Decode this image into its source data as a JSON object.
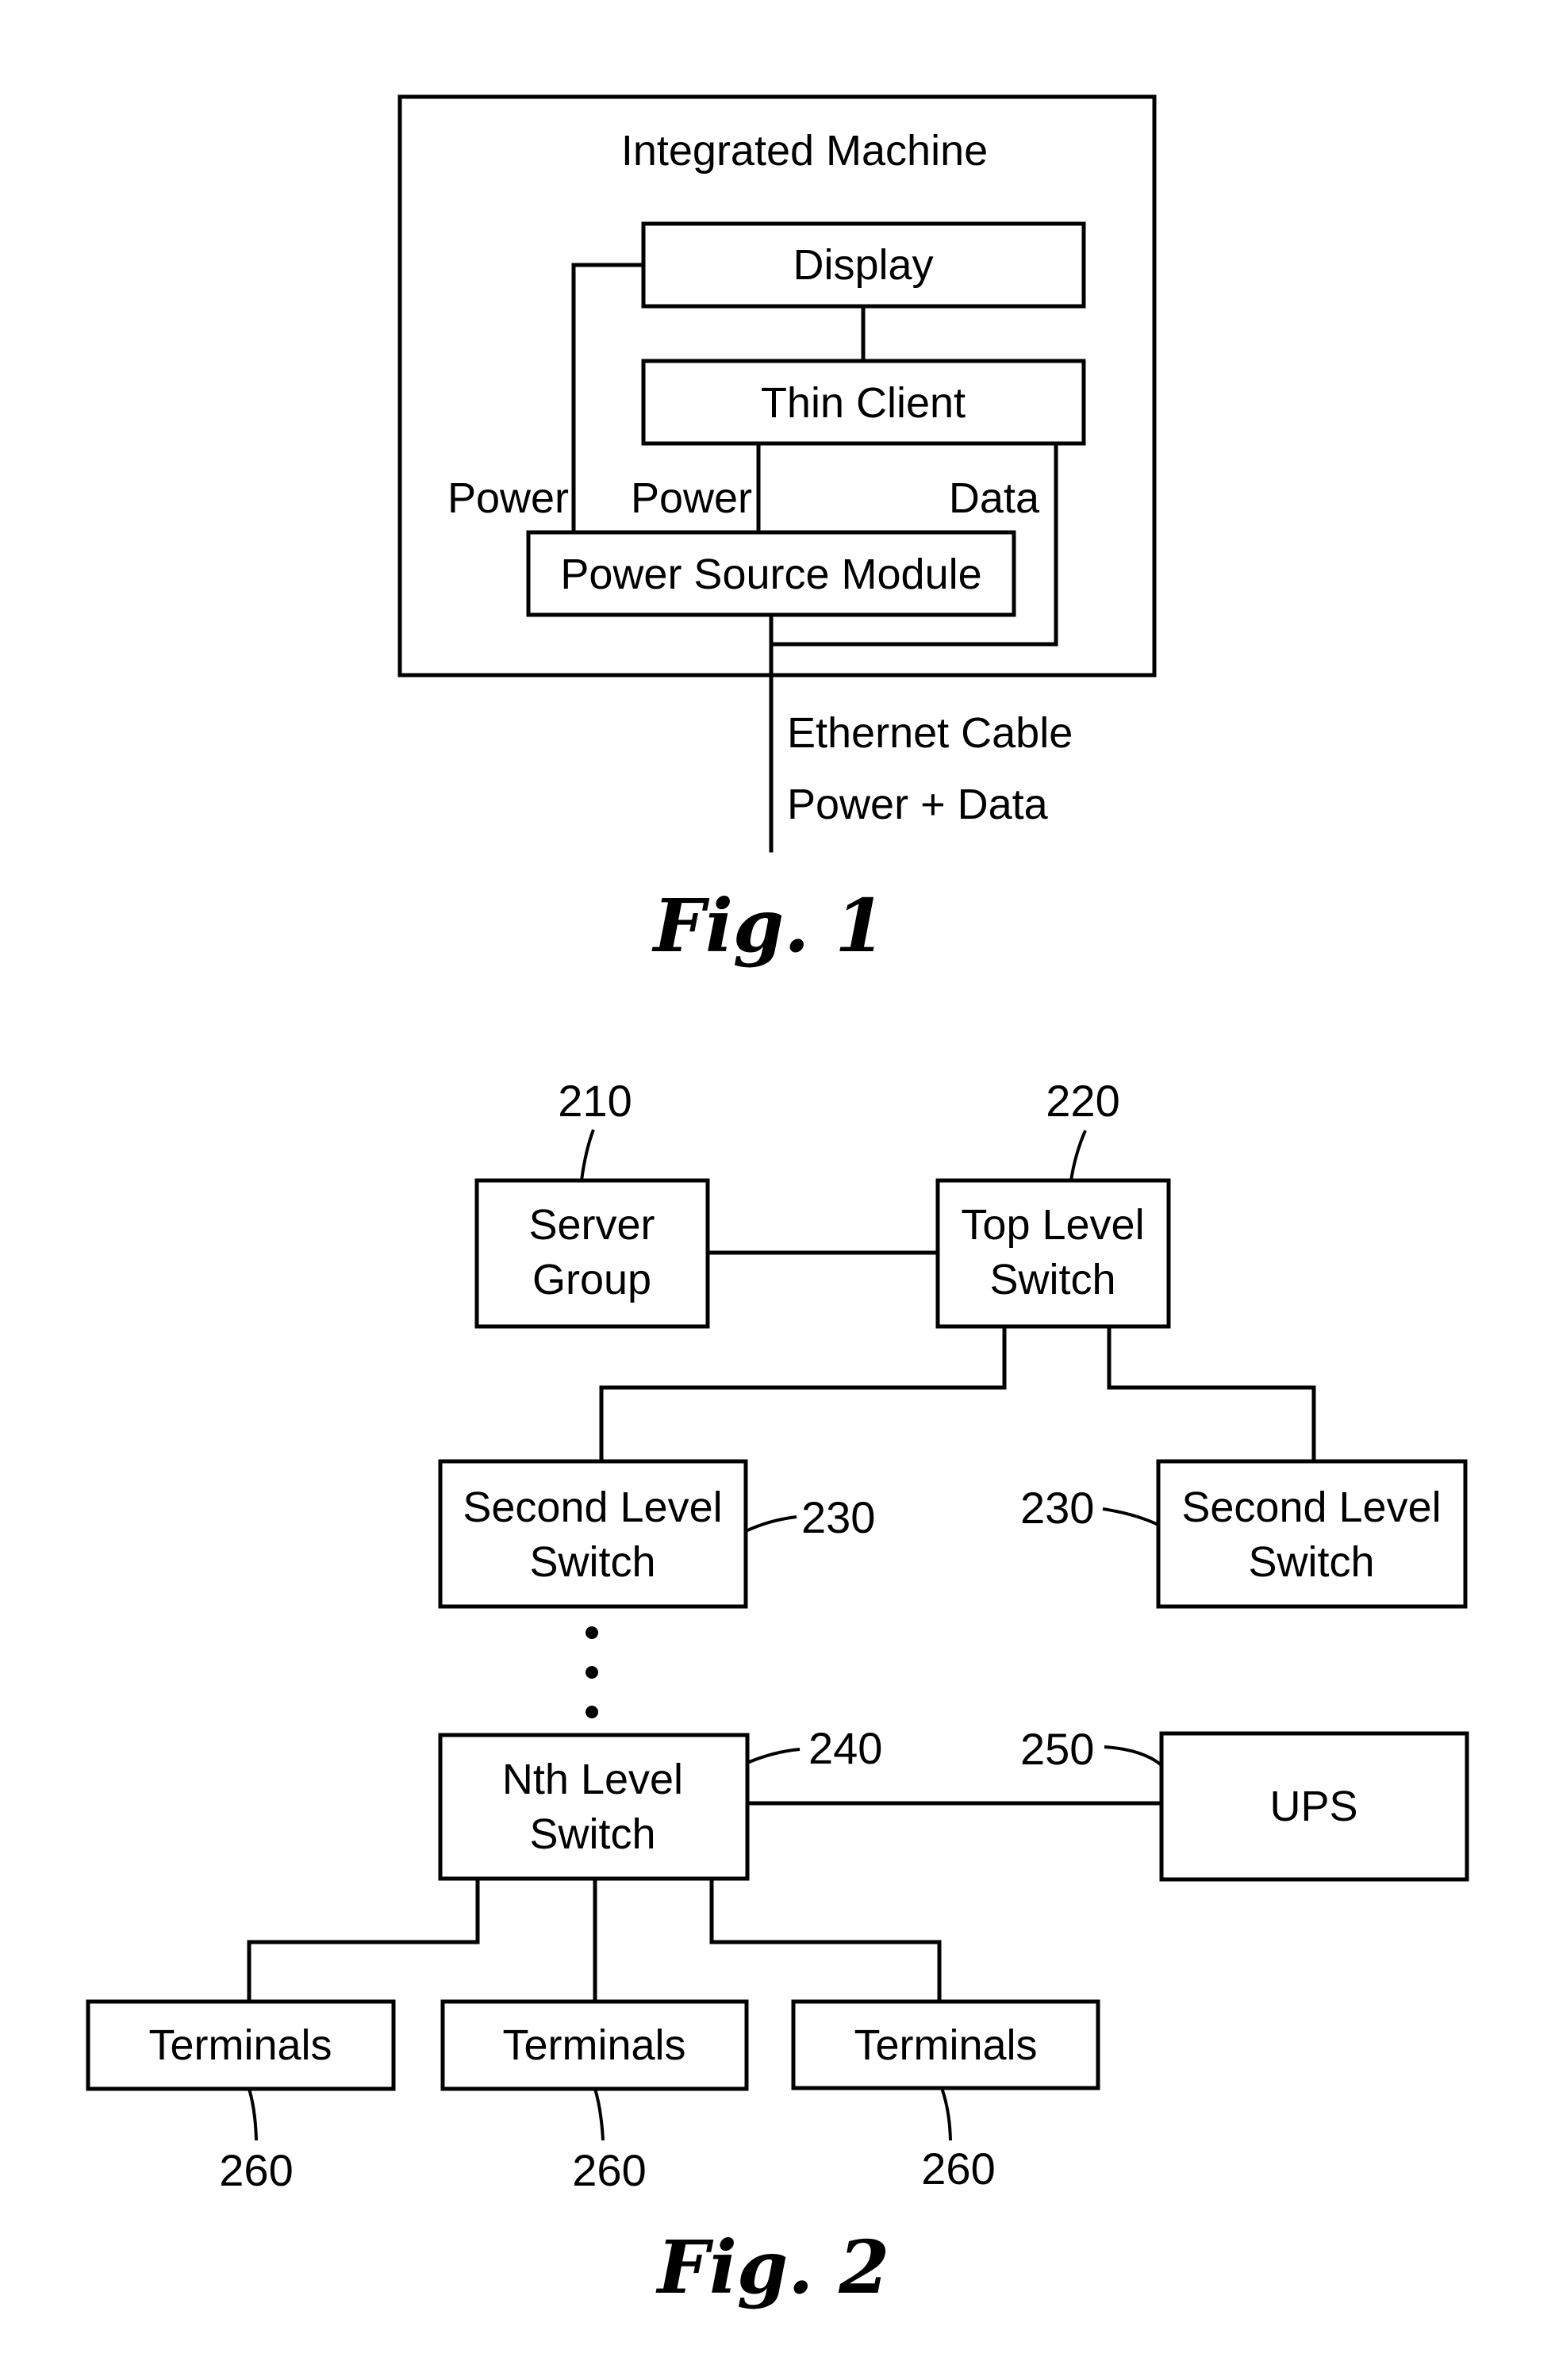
{
  "figure1": {
    "caption": "Fig. 1",
    "container_label": "Integrated Machine",
    "blocks": {
      "display": "Display",
      "thin_client": "Thin Client",
      "power_source_module": "Power Source Module"
    },
    "wire_labels": {
      "power_to_display": "Power",
      "power_to_thin_client": "Power",
      "data": "Data"
    },
    "cable_labels": [
      "Ethernet Cable",
      "Power + Data"
    ]
  },
  "figure2": {
    "caption": "Fig. 2",
    "nodes": {
      "server_group": {
        "lines": [
          "Server",
          "Group"
        ],
        "ref": "210"
      },
      "top_level_switch": {
        "lines": [
          "Top Level",
          "Switch"
        ],
        "ref": "220"
      },
      "second_level_switch_left": {
        "lines": [
          "Second Level",
          "Switch"
        ],
        "ref": "230"
      },
      "second_level_switch_right": {
        "lines": [
          "Second Level",
          "Switch"
        ],
        "ref": "230"
      },
      "nth_level_switch": {
        "lines": [
          "Nth Level",
          "Switch"
        ],
        "ref": "240"
      },
      "ups": {
        "lines": [
          "UPS"
        ],
        "ref": "250"
      },
      "terminals": [
        {
          "label": "Terminals",
          "ref": "260"
        },
        {
          "label": "Terminals",
          "ref": "260"
        },
        {
          "label": "Terminals",
          "ref": "260"
        }
      ]
    }
  }
}
